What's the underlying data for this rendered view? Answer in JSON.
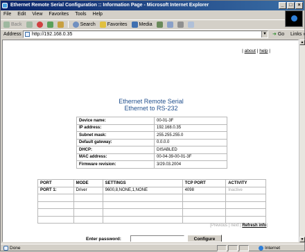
{
  "window": {
    "title": "Ethernet Remote Serial Configuration :: Information Page - Microsoft Internet Explorer"
  },
  "menu": [
    "File",
    "Edit",
    "View",
    "Favorites",
    "Tools",
    "Help"
  ],
  "toolbar": {
    "back": "Back",
    "search": "Search",
    "favorites": "Favorites",
    "media": "Media"
  },
  "address": {
    "label": "Address",
    "url": "http://192.168.0.35",
    "go": "Go",
    "links": "Links"
  },
  "links": {
    "about": "about",
    "sep": " | ",
    "help": "help"
  },
  "page": {
    "title_line1": "Ethernet Remote Serial",
    "title_line2": "Ethernet to RS-232"
  },
  "info": [
    {
      "key": "Device name:",
      "value": "00-01-3F"
    },
    {
      "key": "IP address:",
      "value": "192.168.0.35"
    },
    {
      "key": "Subnet mask:",
      "value": "255.255.255.0"
    },
    {
      "key": "Default gateway:",
      "value": "0.0.0.0"
    },
    {
      "key": "DHCP:",
      "value": "DISABLED"
    },
    {
      "key": "MAC address:",
      "value": "00-04-39-00-01-3F"
    },
    {
      "key": "Firmware revision:",
      "value": "3/29.03.2004"
    }
  ],
  "ports": {
    "headers": [
      "PORT",
      "MODE",
      "SETTINGS",
      "TCP PORT",
      "ACTIVITY"
    ],
    "rows": [
      [
        "PORT 1:",
        "Driver",
        "9600,8,NONE,1,NONE",
        "4098",
        "Inactive"
      ]
    ]
  },
  "pager": {
    "previous": "Previous",
    "next": "next",
    "refresh": "Refresh info"
  },
  "password": {
    "label": "Enter password:",
    "button": "Configure"
  },
  "status": {
    "left": "Done",
    "zone": "Internet"
  }
}
